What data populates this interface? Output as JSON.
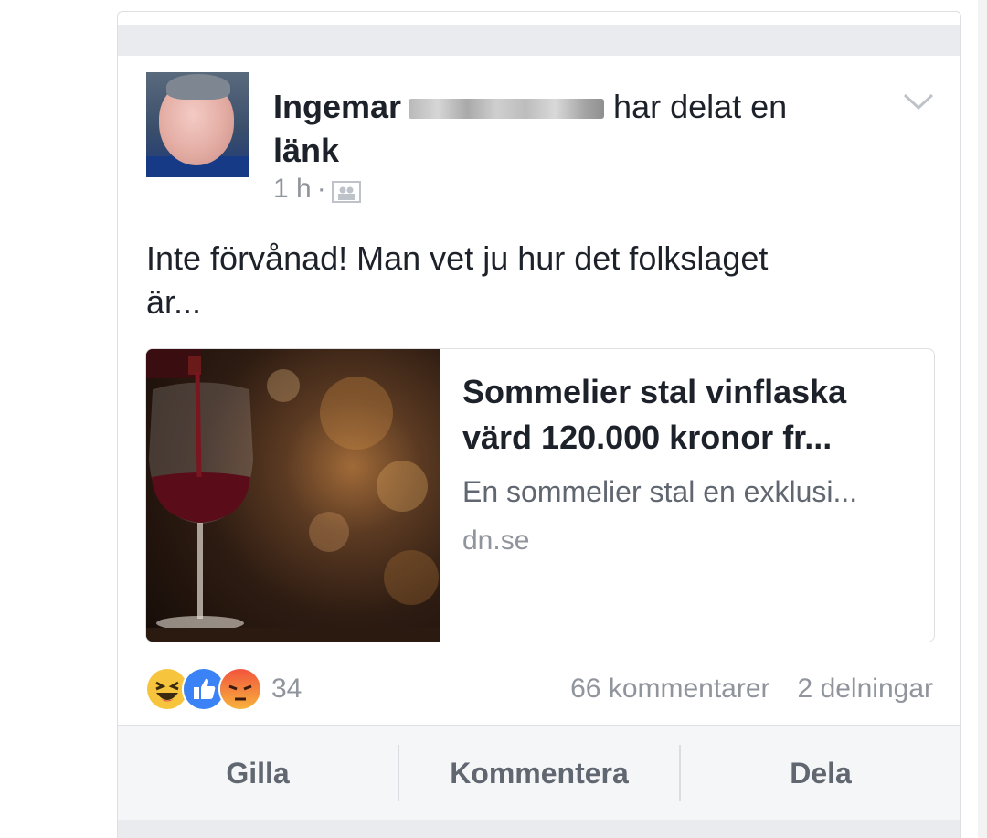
{
  "post": {
    "author": "Ingemar",
    "action_text": "har delat en",
    "action_text_2": "länk",
    "time": "1 h",
    "separator": "·",
    "audience_icon": "friends-icon",
    "body_line1": "Inte förvånad! Man vet ju hur det folkslaget",
    "body_line2": "är...",
    "menu_icon": "chevron-down-icon"
  },
  "link": {
    "title_line1": "Sommelier stal vinflaska",
    "title_line2": "värd 120.000 kronor fr...",
    "description": "En sommelier stal en exklusi...",
    "domain": "dn.se"
  },
  "reactions": {
    "icons": [
      "haha-icon",
      "like-icon",
      "angry-icon"
    ],
    "count": "34"
  },
  "stats": {
    "comments": "66 kommentarer",
    "shares": "2 delningar"
  },
  "actions": {
    "like": "Gilla",
    "comment": "Kommentera",
    "share": "Dela"
  },
  "colors": {
    "like_blue": "#3b82f6",
    "haha_yellow": "#f7c53d",
    "angry_red": "#f1553d",
    "muted_text": "#90949c"
  }
}
